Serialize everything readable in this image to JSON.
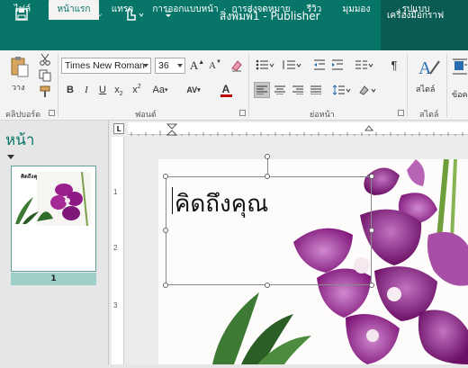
{
  "app": {
    "title": "สิ่งพิมพ์1 - Publisher",
    "context_group": "เครื่องมือกราฟ",
    "accent": "#077568"
  },
  "tabs": [
    {
      "label": "ไฟล์"
    },
    {
      "label": "หน้าแรก",
      "active": true
    },
    {
      "label": "แทรก"
    },
    {
      "label": "การออกแบบหน้า"
    },
    {
      "label": "การส่งจดหมาย"
    },
    {
      "label": "รีวิว"
    },
    {
      "label": "มุมมอง"
    },
    {
      "label": "รูปแบบ"
    }
  ],
  "ribbon": {
    "clipboard": {
      "label": "คลิปบอร์ด",
      "paste_label": "วาง"
    },
    "font": {
      "label": "ฟอนต์",
      "font_name": "Times New Roman",
      "font_size": "36"
    },
    "paragraph": {
      "label": "ย่อหน้า"
    },
    "styles": {
      "label": "สไตล์",
      "styles_button": "สไตล์"
    },
    "arrange": {
      "wrap_label": "ข้อค"
    }
  },
  "nav": {
    "title": "หน้า",
    "thumb_text": "คิดถึงคุณ",
    "page_number": "1"
  },
  "document": {
    "body_text": "คิดถึงคุณ"
  },
  "ruler": {
    "corner": "L",
    "v_ticks": [
      "1",
      "2",
      "3"
    ]
  }
}
